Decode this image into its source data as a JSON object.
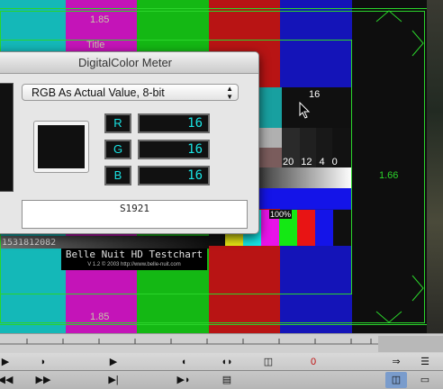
{
  "chart": {
    "top_label": "1.85",
    "bottom_label": "1.85",
    "title_label": "Title",
    "right_label": "1.66",
    "gray_value": "16",
    "steps": [
      "20",
      "12",
      "4",
      "0"
    ],
    "percent": "100%",
    "timecode": "1531812082",
    "banner_title": "Belle Nuit HD Testchart",
    "banner_sub": "V 1.2 © 2003 http://www.belle-nuit.com",
    "colors": {
      "cyan": "#14b8b8",
      "magenta": "#c414b8",
      "green": "#14b814",
      "red": "#b81414",
      "blue": "#1414b8",
      "guide_green": "#2bd42b"
    }
  },
  "meter": {
    "title": "DigitalColor Meter",
    "mode": "RGB As Actual Value, 8-bit",
    "r_label": "R",
    "g_label": "G",
    "b_label": "B",
    "r_value": "16",
    "g_value": "16",
    "b_value": "16",
    "swatch_color": "#101010",
    "footer": "S1921"
  },
  "controls": {
    "marker": "0"
  }
}
